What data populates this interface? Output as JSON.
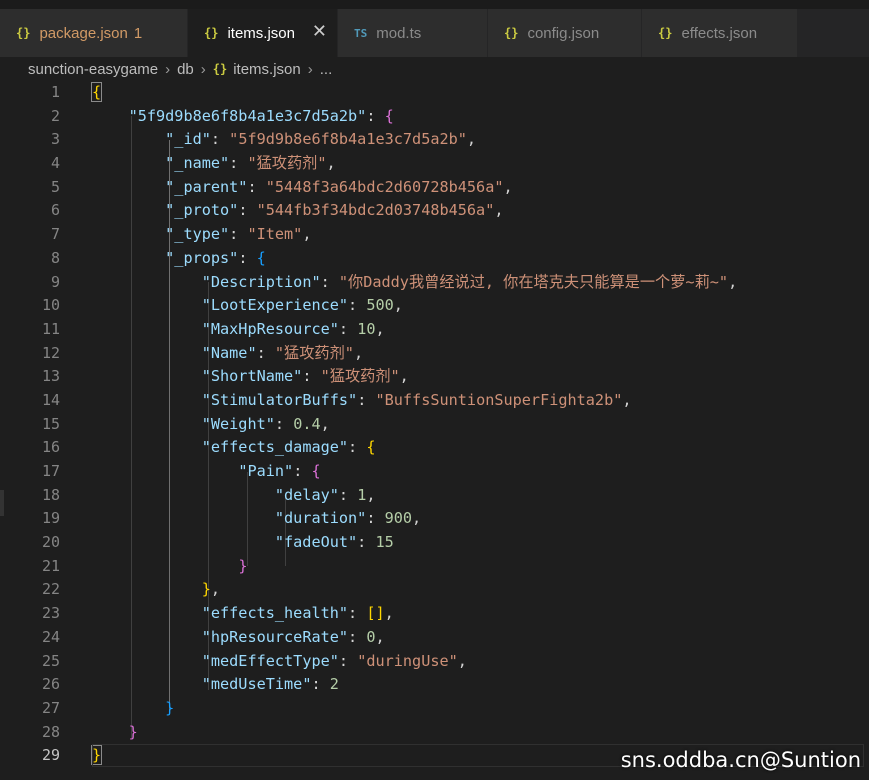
{
  "tabs": [
    {
      "label": "package.json",
      "icon": "{}",
      "badge": "1"
    },
    {
      "label": "items.json",
      "icon": "{}",
      "close": "✕"
    },
    {
      "label": "mod.ts",
      "icon": "TS"
    },
    {
      "label": "config.json",
      "icon": "{}"
    },
    {
      "label": "effects.json",
      "icon": "{}"
    }
  ],
  "breadcrumb": {
    "root": "sunction-easygame",
    "sep": "›",
    "folder": "db",
    "icon": "{}",
    "file": "items.json",
    "tail": "..."
  },
  "lines": {
    "id_key": "\"5f9d9b8e6f8b4a1e3c7d5a2b\"",
    "_id": {
      "k": "\"_id\"",
      "v": "\"5f9d9b8e6f8b4a1e3c7d5a2b\""
    },
    "_name": {
      "k": "\"_name\"",
      "v": "\"猛攻药剂\""
    },
    "_parent": {
      "k": "\"_parent\"",
      "v": "\"5448f3a64bdc2d60728b456a\""
    },
    "_proto": {
      "k": "\"_proto\"",
      "v": "\"544fb3f34bdc2d03748b456a\""
    },
    "_type": {
      "k": "\"_type\"",
      "v": "\"Item\""
    },
    "_props": {
      "k": "\"_props\""
    },
    "Description": {
      "k": "\"Description\"",
      "v": "\"你Daddy我曾经说过, 你在塔克夫只能算是一个萝~莉~\""
    },
    "LootExperience": {
      "k": "\"LootExperience\"",
      "v": "500"
    },
    "MaxHpResource": {
      "k": "\"MaxHpResource\"",
      "v": "10"
    },
    "Name": {
      "k": "\"Name\"",
      "v": "\"猛攻药剂\""
    },
    "ShortName": {
      "k": "\"ShortName\"",
      "v": "\"猛攻药剂\""
    },
    "StimulatorBuffs": {
      "k": "\"StimulatorBuffs\"",
      "v": "\"BuffsSuntionSuperFighta2b\""
    },
    "Weight": {
      "k": "\"Weight\"",
      "v": "0.4"
    },
    "effects_damage": {
      "k": "\"effects_damage\""
    },
    "Pain": {
      "k": "\"Pain\""
    },
    "delay": {
      "k": "\"delay\"",
      "v": "1"
    },
    "duration": {
      "k": "\"duration\"",
      "v": "900"
    },
    "fadeOut": {
      "k": "\"fadeOut\"",
      "v": "15"
    },
    "effects_health": {
      "k": "\"effects_health\"",
      "v": "[]"
    },
    "hpResourceRate": {
      "k": "\"hpResourceRate\"",
      "v": "0"
    },
    "medEffectType": {
      "k": "\"medEffectType\"",
      "v": "\"duringUse\""
    },
    "medUseTime": {
      "k": "\"medUseTime\"",
      "v": "2"
    }
  },
  "line_numbers": [
    "1",
    "2",
    "3",
    "4",
    "5",
    "6",
    "7",
    "8",
    "9",
    "10",
    "11",
    "12",
    "13",
    "14",
    "15",
    "16",
    "17",
    "18",
    "19",
    "20",
    "21",
    "22",
    "23",
    "24",
    "25",
    "26",
    "27",
    "28",
    "29"
  ],
  "watermark": "sns.oddba.cn@Suntion",
  "icons": {
    "json": "json-braces-icon",
    "ts": "typescript-icon",
    "close": "close-icon"
  }
}
